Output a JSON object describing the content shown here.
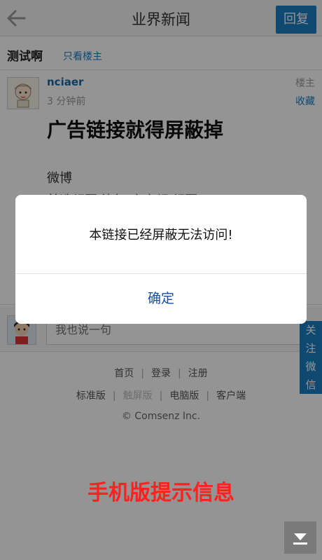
{
  "header": {
    "title": "业界新闻",
    "reply_label": "回复",
    "back_icon": "back-arrow-icon"
  },
  "thread": {
    "title": "测试啊",
    "only_op_label": "只看楼主"
  },
  "post": {
    "author": "nciaer",
    "time": "3 分钟前",
    "floor_label": "楼主",
    "fav_label": "收藏",
    "heading": "广告链接就得屏蔽掉",
    "line1": "微博",
    "line2": "首选都要 比如 人人都 都要"
  },
  "reply_bar": {
    "placeholder": "我也说一句"
  },
  "follow_tab": {
    "chars": [
      "关",
      "注",
      "微",
      "信"
    ]
  },
  "footer": {
    "row1": [
      "首页",
      "登录",
      "注册"
    ],
    "row2": [
      "标准版",
      "触屏版",
      "电脑版",
      "客户端"
    ],
    "current_version": "触屏版",
    "copyright": "© Comsenz Inc."
  },
  "dialog": {
    "message": "本链接已经屏蔽无法访问!",
    "ok_label": "确定"
  },
  "caption": "手机版提示信息",
  "colors": {
    "accent": "#1a7fc4",
    "caption": "#ff2020",
    "dialog_ok": "#1a4fa0"
  }
}
